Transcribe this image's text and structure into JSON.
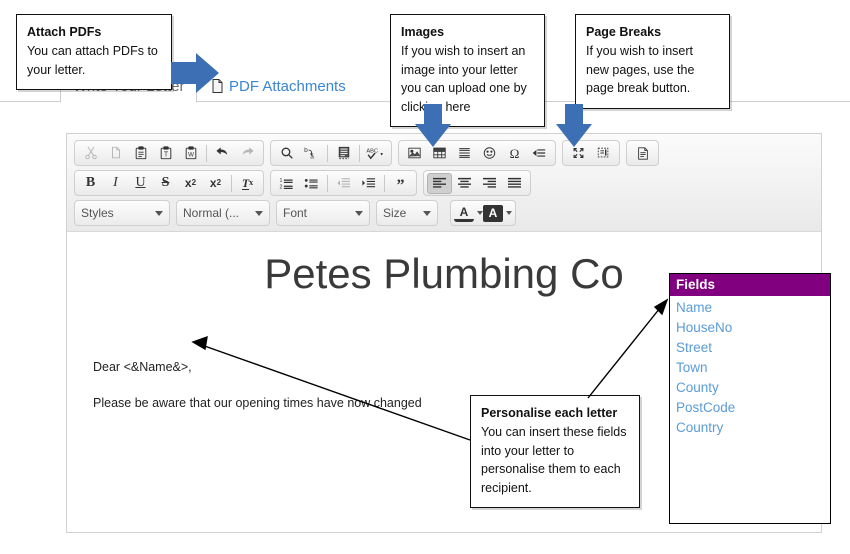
{
  "tabs": [
    {
      "label": "Write Your Letter",
      "active": true
    },
    {
      "label": "PDF Attachments",
      "active": false,
      "icon": "page-icon"
    }
  ],
  "callouts": [
    {
      "id": "attach-pdfs",
      "title": "Attach PDFs",
      "body": "You can attach PDFs to your letter."
    },
    {
      "id": "images",
      "title": "Images",
      "body": "If you wish to insert an image into your letter you can upload one by clicking here"
    },
    {
      "id": "page-breaks",
      "title": "Page Breaks",
      "body": "If you wish to insert new pages, use the page break button."
    },
    {
      "id": "personalise-letter",
      "title": "Personalise each letter",
      "body": "You can insert these fields into your letter to personalise them to each recipient."
    }
  ],
  "toolbar": {
    "row1": [
      {
        "group": [
          {
            "name": "cut-icon",
            "title": "Cut",
            "disabled": true
          },
          {
            "name": "copy-icon",
            "title": "Copy",
            "disabled": true
          },
          {
            "name": "paste-icon",
            "title": "Paste"
          },
          {
            "name": "paste-as-text-icon",
            "title": "Paste as plain text"
          },
          {
            "name": "paste-from-word-icon",
            "title": "Paste from Word"
          },
          {
            "name": "separator"
          },
          {
            "name": "undo-icon",
            "title": "Undo"
          },
          {
            "name": "redo-icon",
            "title": "Redo",
            "disabled": true
          }
        ]
      },
      {
        "group": [
          {
            "name": "find-icon",
            "title": "Find"
          },
          {
            "name": "replace-icon",
            "title": "Replace"
          },
          {
            "name": "separator"
          },
          {
            "name": "select-all-icon",
            "title": "Select All"
          },
          {
            "name": "separator"
          },
          {
            "name": "spell-check-icon",
            "title": "Spell Check As You Type",
            "dropdown": true
          }
        ]
      },
      {
        "group": [
          {
            "name": "image-icon",
            "title": "Image"
          },
          {
            "name": "table-icon",
            "title": "Table"
          },
          {
            "name": "horizontal-rule-icon",
            "title": "Horizontal Line"
          },
          {
            "name": "smiley-icon",
            "title": "Smiley"
          },
          {
            "name": "special-character-icon",
            "title": "Insert Special Character"
          },
          {
            "name": "page-break-icon",
            "title": "Insert Page Break"
          }
        ]
      },
      {
        "group": [
          {
            "name": "maximize-icon",
            "title": "Maximize"
          },
          {
            "name": "show-blocks-icon",
            "title": "Show Blocks"
          }
        ]
      },
      {
        "group": [
          {
            "name": "templates-icon",
            "title": "Templates"
          }
        ]
      }
    ],
    "row2": [
      {
        "group": [
          {
            "name": "bold-icon",
            "label": "B",
            "title": "Bold"
          },
          {
            "name": "italic-icon",
            "label": "I",
            "title": "Italic"
          },
          {
            "name": "underline-icon",
            "label": "U",
            "title": "Underline"
          },
          {
            "name": "strikethrough-icon",
            "label": "S",
            "title": "Strikethrough"
          },
          {
            "name": "subscript-icon",
            "title": "Subscript"
          },
          {
            "name": "superscript-icon",
            "title": "Superscript"
          },
          {
            "name": "separator"
          },
          {
            "name": "remove-format-icon",
            "title": "Remove Format"
          }
        ]
      },
      {
        "group": [
          {
            "name": "numbered-list-icon",
            "title": "Insert/Remove Numbered List"
          },
          {
            "name": "bulleted-list-icon",
            "title": "Insert/Remove Bulleted List"
          },
          {
            "name": "separator"
          },
          {
            "name": "decrease-indent-icon",
            "title": "Decrease Indent",
            "disabled": true
          },
          {
            "name": "increase-indent-icon",
            "title": "Increase Indent"
          },
          {
            "name": "separator"
          },
          {
            "name": "blockquote-icon",
            "title": "Block Quote"
          }
        ]
      },
      {
        "group": [
          {
            "name": "align-left-icon",
            "title": "Align Left",
            "active": true
          },
          {
            "name": "align-center-icon",
            "title": "Center"
          },
          {
            "name": "align-right-icon",
            "title": "Align Right"
          },
          {
            "name": "justify-icon",
            "title": "Justify"
          }
        ]
      }
    ],
    "row3": {
      "selects": [
        {
          "name": "styles-select",
          "value": "Styles"
        },
        {
          "name": "format-select",
          "value": "Normal (..."
        },
        {
          "name": "font-select",
          "value": "Font"
        },
        {
          "name": "size-select",
          "value": "Size"
        }
      ],
      "colors": [
        {
          "name": "text-color-button",
          "label": "A",
          "title": "Text Color"
        },
        {
          "name": "bg-color-button",
          "label": "A",
          "title": "Background Color"
        }
      ]
    }
  },
  "document": {
    "title": "Petes Plumbing Co",
    "paragraphs": [
      "Dear <&Name&>,",
      "Please be aware that our opening times have now changed"
    ]
  },
  "fields_panel": {
    "header": "Fields",
    "items": [
      "Name",
      "HouseNo",
      "Street",
      "Town",
      "County",
      "PostCode",
      "Country"
    ]
  },
  "colors": {
    "fields_header_bg": "#800080",
    "field_link": "#5b9bd5",
    "tab_link": "#3a86d4",
    "arrow_blue": "#3c6fb3",
    "annotation_arrow": "#000000"
  }
}
